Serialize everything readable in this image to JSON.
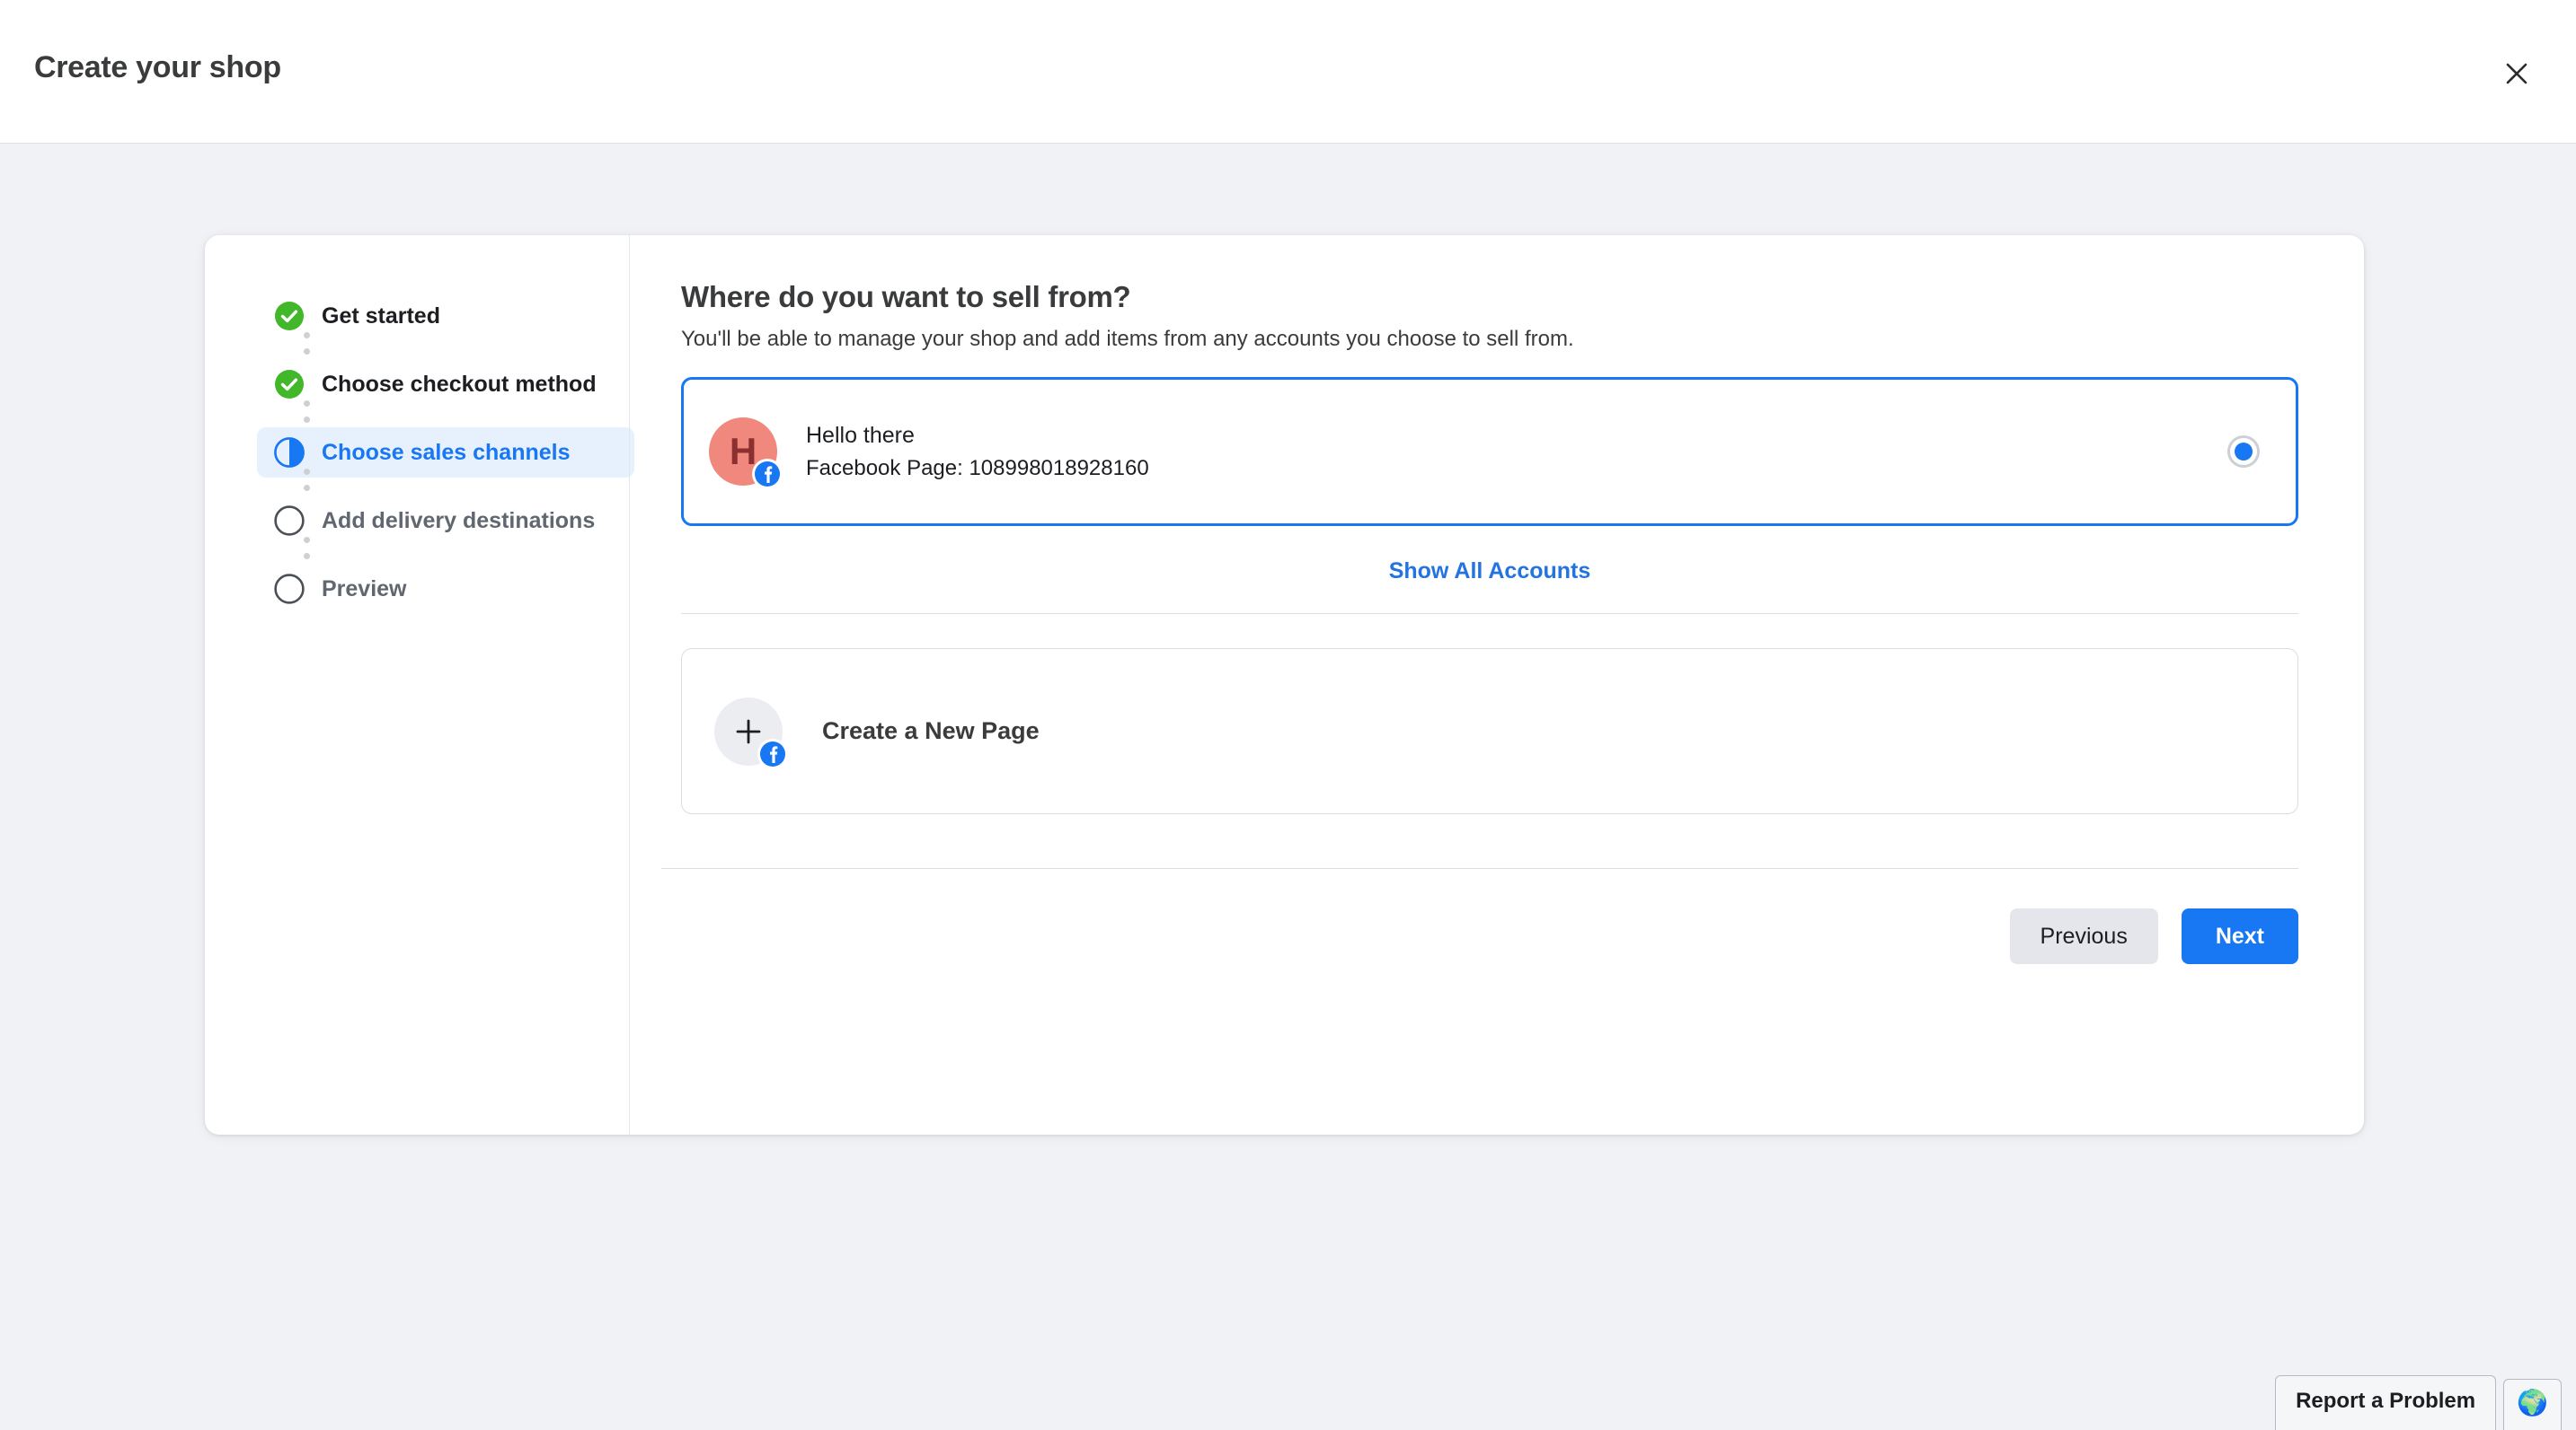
{
  "header": {
    "title": "Create your shop",
    "close_icon": "close-icon"
  },
  "stepper": {
    "steps": [
      {
        "label": "Get started",
        "state": "done",
        "icon": "check-circle-icon"
      },
      {
        "label": "Choose checkout method",
        "state": "done",
        "icon": "check-circle-icon"
      },
      {
        "label": "Choose sales channels",
        "state": "active",
        "icon": "half-circle-icon"
      },
      {
        "label": "Add delivery destinations",
        "state": "todo",
        "icon": "empty-circle-icon"
      },
      {
        "label": "Preview",
        "state": "todo",
        "icon": "empty-circle-icon"
      }
    ]
  },
  "content": {
    "title": "Where do you want to sell from?",
    "subtitle": "You'll be able to manage your shop and add items from any accounts you choose to sell from.",
    "account": {
      "avatar_initial": "H",
      "name": "Hello there",
      "meta": "Facebook Page: 108998018928160",
      "selected": true,
      "badge_icon": "facebook-icon"
    },
    "show_all_label": "Show All Accounts",
    "create_new_page": {
      "label": "Create a New Page",
      "plus_icon": "plus-icon",
      "badge_icon": "facebook-icon"
    },
    "buttons": {
      "previous": "Previous",
      "next": "Next"
    }
  },
  "footer": {
    "report_label": "Report a Problem",
    "globe_icon": "globe-icon",
    "globe_glyph": "🌍"
  },
  "colors": {
    "accent_blue": "#1877f2",
    "link_blue": "#2374e1",
    "done_green": "#42b72a",
    "page_bg": "#f0f2f5",
    "avatar_bg": "#f0887e"
  }
}
